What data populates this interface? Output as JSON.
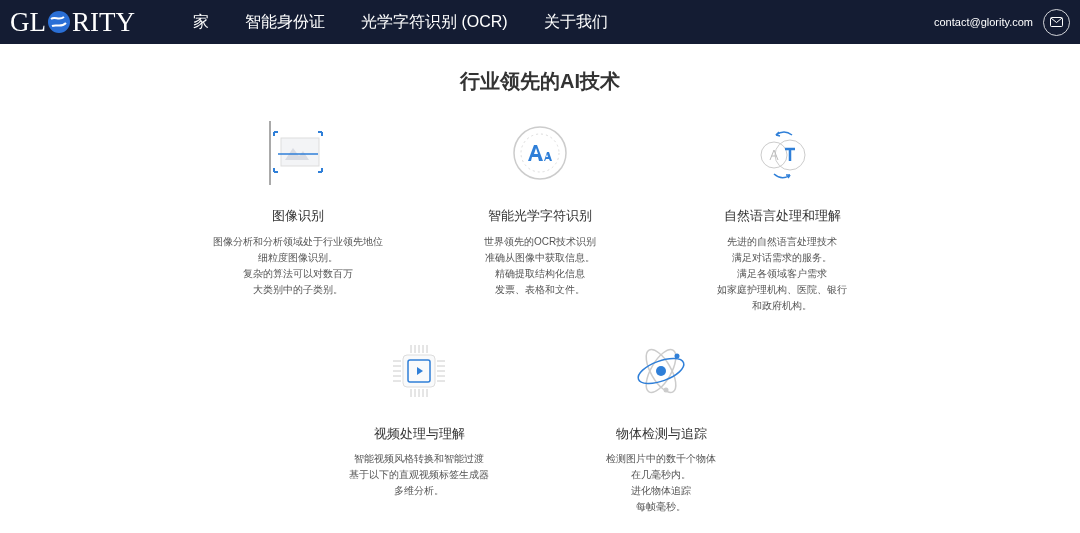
{
  "header": {
    "logo": {
      "before": "GL",
      "after": "RITY"
    },
    "nav": [
      {
        "label": "家"
      },
      {
        "label": "智能身份证"
      },
      {
        "label": "光学字符识别 (OCR)"
      },
      {
        "label": "关于我们"
      }
    ],
    "email": "contact@glority.com"
  },
  "section": {
    "title": "行业领先的AI技术",
    "rows": [
      [
        {
          "kind": "image",
          "title": "图像识别",
          "lines": [
            "图像分析和分析领域处于行业领先地位",
            "细粒度图像识别。",
            "复杂的算法可以对数百万",
            "大类别中的子类别。"
          ]
        },
        {
          "kind": "ocr",
          "title": "智能光学字符识别",
          "lines": [
            "世界领先的OCR技术识别",
            "准确从图像中获取信息。",
            "精确提取结构化信息",
            "发票、表格和文件。"
          ]
        },
        {
          "kind": "nlp",
          "title": "自然语言处理和理解",
          "lines": [
            "先进的自然语言处理技术",
            "满足对话需求的服务。",
            "满足各领域客户需求",
            "如家庭护理机构、医院、银行",
            "和政府机构。"
          ]
        }
      ],
      [
        {
          "kind": "video",
          "title": "视频处理与理解",
          "lines": [
            "智能视频风格转换和智能过渡",
            "基于以下的直观视频标签生成器",
            "多维分析。"
          ]
        },
        {
          "kind": "object",
          "title": "物体检测与追踪",
          "lines": [
            "检测图片中的数千个物体",
            "在几毫秒内。",
            "进化物体追踪",
            "每帧毫秒。"
          ]
        }
      ]
    ]
  }
}
